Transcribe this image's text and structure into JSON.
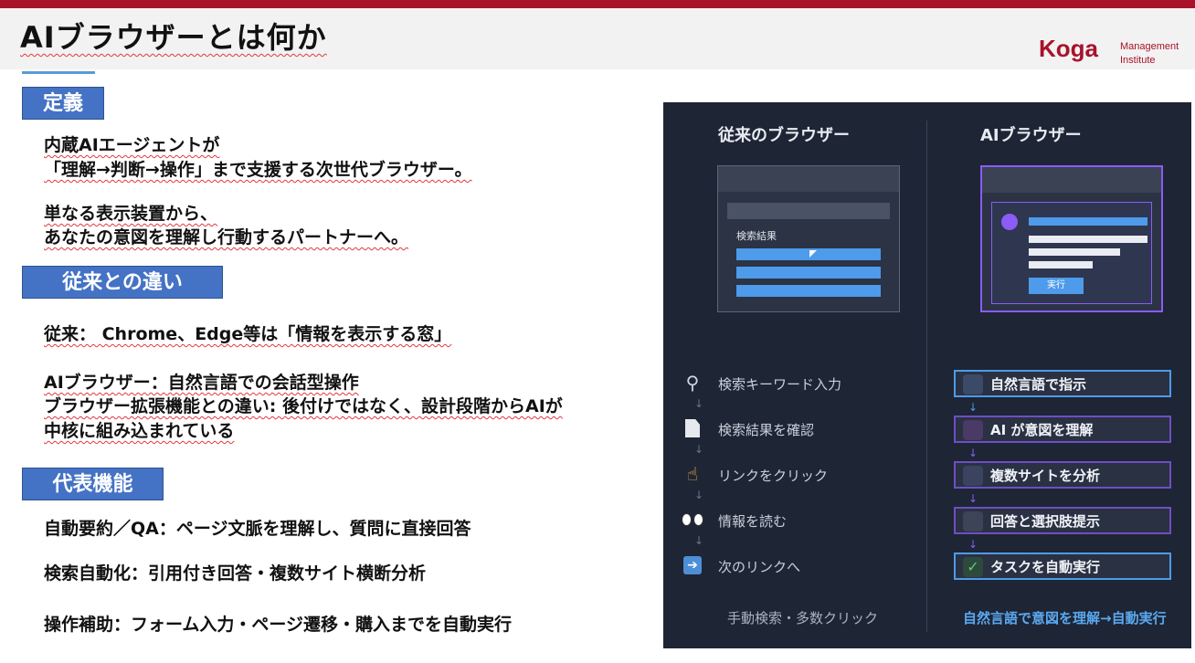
{
  "header": {
    "title": "AIブラウザーとは何か",
    "logo_main": "Koga",
    "logo_sub_1": "Management",
    "logo_sub_2": "Institute"
  },
  "sections": {
    "definition": {
      "heading": "定義",
      "line1": "内蔵AIエージェントが",
      "line2": "「理解→判断→操作」まで支援する次世代ブラウザー。",
      "line3": "単なる表示装置から、",
      "line4": "あなたの意図を理解し行動するパートナーへ。"
    },
    "difference": {
      "heading": "従来との違い",
      "line1": "従来：  Chrome、Edge等は「情報を表示する窓」",
      "line2": "AIブラウザー：自然言語での会話型操作",
      "line3": "ブラウザー拡張機能との違い: 後付けではなく、設計段階からAIが",
      "line4": "中核に組み込まれている"
    },
    "features": {
      "heading": "代表機能",
      "item1": "自動要約／QA：ページ文脈を理解し、質問に直接回答",
      "item2": "検索自動化：引用付き回答・複数サイト横断分析",
      "item3": "操作補助：フォーム入力・ページ遷移・購入までを自動実行"
    }
  },
  "comparison": {
    "left": {
      "title": "従来のブラウザー",
      "mock_label": "検索結果",
      "steps": [
        "検索キーワード入力",
        "検索結果を確認",
        "リンクをクリック",
        "情報を読む",
        "次のリンクへ"
      ],
      "step_icons": [
        "magnifier-icon",
        "document-icon",
        "pointing-hand-icon",
        "eyes-icon",
        "arrow-right-icon"
      ],
      "footer": "手動検索・多数クリック"
    },
    "right": {
      "title": "AIブラウザー",
      "mock_button": "実行",
      "steps": [
        "自然言語で指示",
        "AI が意図を理解",
        "複数サイトを分析",
        "回答と選択肢提示",
        "タスクを自動実行"
      ],
      "step_icons": [
        "speech-bubble-icon",
        "brain-icon",
        "refresh-icon",
        "chart-icon",
        "check-icon"
      ],
      "footer": "自然言語で意図を理解→自動実行"
    },
    "colors": {
      "panel_bg": "#1e2535",
      "accent_blue": "#4d9bea",
      "accent_purple": "#8b5cf6",
      "footer_blue": "#5aa9f0"
    }
  }
}
